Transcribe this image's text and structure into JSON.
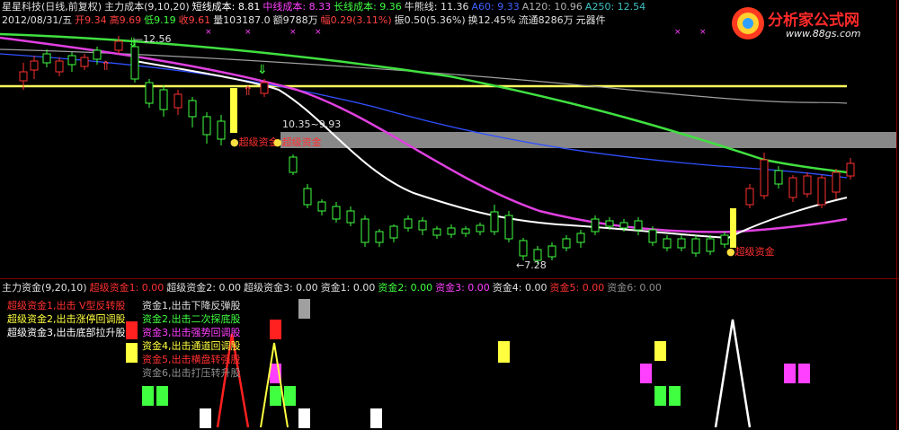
{
  "header": {
    "line1": [
      {
        "text": "星星科技(日线,前复权)",
        "color": "#e0e0e0"
      },
      {
        "text": "主力成本(9,10,20)",
        "color": "#e0e0e0"
      },
      {
        "text": "短线成本: 8.81",
        "color": "#ffffff"
      },
      {
        "text": "中线成本: 8.33",
        "color": "#ff40ff"
      },
      {
        "text": "长线成本: 9.36",
        "color": "#40ff40"
      },
      {
        "text": "牛熊线: 11.36",
        "color": "#e0e0e0"
      },
      {
        "text": "A60: 9.33",
        "color": "#4060ff"
      },
      {
        "text": "A120: 10.96",
        "color": "#b0b0b0"
      },
      {
        "text": "A250: 12.54",
        "color": "#40c0c0"
      }
    ],
    "line2": [
      {
        "text": "2012/08/31/五",
        "color": "#e0e0e0"
      },
      {
        "text": "开9.34",
        "color": "#ff4040"
      },
      {
        "text": "高9.69",
        "color": "#ff4040"
      },
      {
        "text": "低9.19",
        "color": "#40ff40"
      },
      {
        "text": "收9.61",
        "color": "#ff4040"
      },
      {
        "text": "量103187.0",
        "color": "#e0e0e0"
      },
      {
        "text": "额9788万",
        "color": "#e0e0e0"
      },
      {
        "text": "幅0.29(3.11%)",
        "color": "#ff4040"
      },
      {
        "text": "振0.50(5.36%)",
        "color": "#e0e0e0"
      },
      {
        "text": "换12.45%",
        "color": "#e0e0e0"
      },
      {
        "text": "流通8286万",
        "color": "#e0e0e0"
      },
      {
        "text": "元器件",
        "color": "#e0e0e0"
      }
    ]
  },
  "logo": {
    "name": "分析家公式网",
    "url": "www.88gs.com"
  },
  "chart_annotations": {
    "high_label": "12.56",
    "mid_label": "10.35~9.93",
    "low_label": "7.28",
    "signal1": "超级资金",
    "signal2": "超级资金",
    "signal3": "超级资金"
  },
  "indicator_header": [
    {
      "text": "主力资金(9,20,10)",
      "color": "#e0e0e0"
    },
    {
      "text": "超级资金1: 0.00",
      "color": "#ff3030"
    },
    {
      "text": "超级资金2: 0.00",
      "color": "#e0e0e0"
    },
    {
      "text": "超级资金3: 0.00",
      "color": "#e0e0e0"
    },
    {
      "text": "资金1: 0.00",
      "color": "#e0e0e0"
    },
    {
      "text": "资金2: 0.00",
      "color": "#40ff40"
    },
    {
      "text": "资金3: 0.00",
      "color": "#ff40ff"
    },
    {
      "text": "资金4: 0.00",
      "color": "#e0e0e0"
    },
    {
      "text": "资金5: 0.00",
      "color": "#ff3030"
    },
    {
      "text": "资金6: 0.00",
      "color": "#909090"
    }
  ],
  "legend_left": [
    {
      "text": "超级资金1,出击 V型反转股",
      "color": "#ff3030"
    },
    {
      "text": "超级资金2,出击涨停回调股",
      "color": "#ffff40"
    },
    {
      "text": "超级资金3,出击底部拉升股",
      "color": "#ffffff"
    }
  ],
  "legend_right": [
    {
      "text": "资金1,出击下降反弹股",
      "color": "#e0e0e0"
    },
    {
      "text": "资金2,出击二次探底股",
      "color": "#40ff40"
    },
    {
      "text": "资金3,出击强势回调股",
      "color": "#ff40ff"
    },
    {
      "text": "资金4,出击通道回调股",
      "color": "#ffff40"
    },
    {
      "text": "资金5,出击横盘转强股",
      "color": "#ff3030"
    },
    {
      "text": "资金6,出击打压转升股",
      "color": "#909090"
    }
  ]
}
